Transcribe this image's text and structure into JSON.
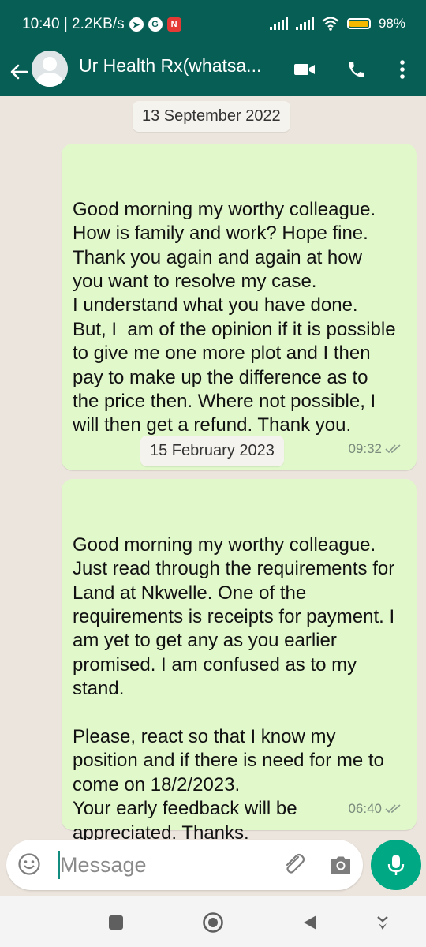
{
  "status_bar": {
    "time_speed": "10:40 | 2.2KB/s",
    "notification_icons": [
      "telegram-icon",
      "google-icon",
      "news-icon"
    ],
    "battery_percent": "98%",
    "battery_level": 0.98
  },
  "header": {
    "chat_title": "Ur Health Rx(whatsa...",
    "icons": [
      "back-arrow-icon",
      "avatar",
      "video-call-icon",
      "phone-call-icon",
      "more-options-icon"
    ]
  },
  "messages": [
    {
      "date": "13 September 2022",
      "text": "Good morning my worthy colleague.\nHow is family and work? Hope fine. Thank you again and again at how you want to resolve my case.\nI understand what you have done. But, I  am of the opinion if it is possible to give me one more plot and I then pay to make up the difference as to the price then. Where not possible, I will then get a refund. Thank you.",
      "time": "09:32"
    },
    {
      "date": "15 February 2023",
      "text": "Good morning my worthy colleague.\nJust read through the requirements for Land at Nkwelle. One of the requirements is receipts for payment. I am yet to get any as you earlier promised. I am confused as to my stand.\n\nPlease, react so that I know my position and if there is need for me to come on 18/2/2023.\nYour early feedback will be appreciated. Thanks.\nHave a blessed day ahead.",
      "time": "06:40"
    }
  ],
  "input": {
    "placeholder": "Message"
  },
  "colors": {
    "header": "#075E54",
    "bubble_outgoing": "#E1F8CB",
    "chat_background": "#ECE5DD",
    "mic_button": "#00A884"
  }
}
